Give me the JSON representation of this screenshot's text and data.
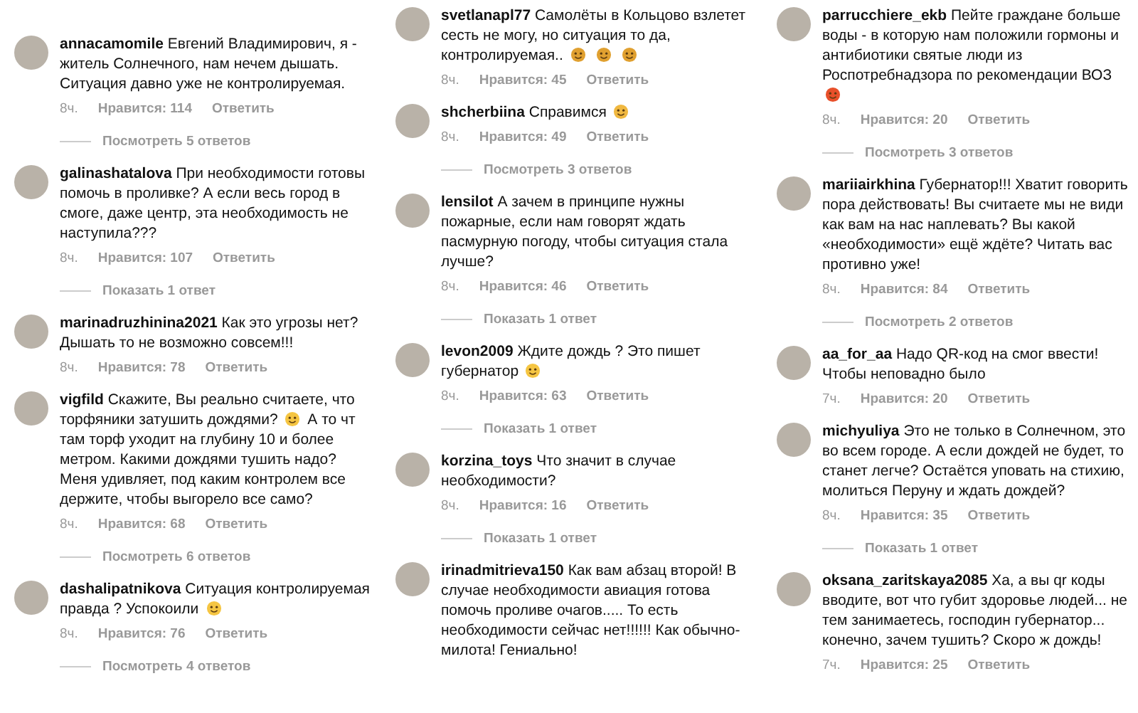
{
  "columns": [
    {
      "comments": [
        {
          "username": "annacamomile",
          "parts": [
            {
              "kind": "text",
              "text": "Евгений Владимирович, я - житель Солнечного, нам нечем дышать. Ситуация давно уже не контролируемая."
            }
          ],
          "time": "8ч.",
          "likes": "Нравится: 114",
          "reply": "Ответить",
          "replies": "Посмотреть 5 ответов"
        },
        {
          "username": "galinashatalova",
          "parts": [
            {
              "kind": "text",
              "text": "При необходимости готовы помочь в проливке? А если весь город в смоге, даже центр, эта необходимость не наступила???"
            }
          ],
          "time": "8ч.",
          "likes": "Нравится: 107",
          "reply": "Ответить",
          "replies": "Показать 1 ответ"
        },
        {
          "username": "marinadruzhinina2021",
          "parts": [
            {
              "kind": "text",
              "text": "Как это угрозы нет? Дышать то не возможно совсем!!!"
            }
          ],
          "time": "8ч.",
          "likes": "Нравится: 78",
          "reply": "Ответить"
        },
        {
          "username": "vigfild",
          "parts": [
            {
              "kind": "text",
              "text": "Скажите, Вы реально считаете, что торфяники затушить дождями?"
            },
            {
              "kind": "emoji",
              "color": "#f5c542"
            },
            {
              "kind": "text",
              "text": "А то  чт там торф уходит на глубину 10 и более метром. Какими дождями тушить надо? Меня удивляет, под каким контролем все держите, чтобы выгорело все само?"
            }
          ],
          "time": "8ч.",
          "likes": "Нравится: 68",
          "reply": "Ответить",
          "replies": "Посмотреть 6 ответов"
        },
        {
          "username": "dashalipatnikova",
          "parts": [
            {
              "kind": "text",
              "text": "Ситуация контролируемая правда ? Успокоили"
            },
            {
              "kind": "emoji",
              "color": "#f5c542"
            }
          ],
          "time": "8ч.",
          "likes": "Нравится: 76",
          "reply": "Ответить",
          "replies": "Посмотреть 4 ответов"
        }
      ]
    },
    {
      "comments": [
        {
          "username": "svetlanapl77",
          "parts": [
            {
              "kind": "text",
              "text": "Самолёты в Кольцово взлетет сесть не могу, но ситуация то да, контролируемая.."
            },
            {
              "kind": "emoji",
              "color": "#e0a030"
            },
            {
              "kind": "emoji",
              "color": "#e0a030"
            },
            {
              "kind": "emoji",
              "color": "#e0a030"
            }
          ],
          "time": "8ч.",
          "likes": "Нравится: 45",
          "reply": "Ответить"
        },
        {
          "username": "shcherbiina",
          "parts": [
            {
              "kind": "text",
              "text": "Справимся"
            },
            {
              "kind": "emoji",
              "color": "#f0b840"
            }
          ],
          "time": "8ч.",
          "likes": "Нравится: 49",
          "reply": "Ответить",
          "replies": "Посмотреть 3 ответов"
        },
        {
          "username": "lensilot",
          "parts": [
            {
              "kind": "text",
              "text": "А зачем в принципе нужны пожарные, если нам говорят ждать пасмурную погоду, чтобы ситуация стала лучше?"
            }
          ],
          "time": "8ч.",
          "likes": "Нравится: 46",
          "reply": "Ответить",
          "replies": "Показать 1 ответ"
        },
        {
          "username": "levon2009",
          "parts": [
            {
              "kind": "text",
              "text": "Ждите дождь ? Это пишет губернатор"
            },
            {
              "kind": "emoji",
              "color": "#f5c542"
            }
          ],
          "time": "8ч.",
          "likes": "Нравится: 63",
          "reply": "Ответить",
          "replies": "Показать 1 ответ"
        },
        {
          "username": "korzina_toys",
          "parts": [
            {
              "kind": "text",
              "text": "Что значит в случае необходимости?"
            }
          ],
          "time": "8ч.",
          "likes": "Нравится: 16",
          "reply": "Ответить",
          "replies": "Показать 1 ответ"
        },
        {
          "username": "irinadmitrieva150",
          "parts": [
            {
              "kind": "text",
              "text": "Как вам абзац второй! В случае необходимости авиация готова помочь проливе очагов..... То есть необходимости сейчас нет!!!!!! Как обычно-милота! Гениально!"
            }
          ]
        }
      ]
    },
    {
      "comments": [
        {
          "username": "parrucchiere_ekb",
          "parts": [
            {
              "kind": "text",
              "text": "Пейте граждане больше воды - в которую нам положили гормоны и антибиотики святые люди из Роспотребнадзора по рекомендации ВОЗ"
            },
            {
              "kind": "emoji",
              "color": "#e8502a"
            }
          ],
          "time": "8ч.",
          "likes": "Нравится: 20",
          "reply": "Ответить",
          "replies": "Посмотреть 3 ответов"
        },
        {
          "username": "mariiairkhina",
          "parts": [
            {
              "kind": "text",
              "text": "Губернатор!!! Хватит говорить пора действовать! Вы считаете мы не види как вам на нас наплевать? Вы какой «необходимости» ещё ждёте? Читать вас противно уже!"
            }
          ],
          "time": "8ч.",
          "likes": "Нравится: 84",
          "reply": "Ответить",
          "replies": "Посмотреть 2 ответов"
        },
        {
          "username": "aa_for_aa",
          "parts": [
            {
              "kind": "text",
              "text": "Надо QR-код на смог ввести! Чтобы неповадно было"
            }
          ],
          "time": "7ч.",
          "likes": "Нравится: 20",
          "reply": "Ответить"
        },
        {
          "username": "michyuliya",
          "parts": [
            {
              "kind": "text",
              "text": "Это не только в Солнечном, это во всем городе. А если дождей не будет, то станет легче? Остаётся уповать на стихию, молиться Перуну и ждать дождей?"
            }
          ],
          "time": "8ч.",
          "likes": "Нравится: 35",
          "reply": "Ответить",
          "replies": "Показать 1 ответ"
        },
        {
          "username": "oksana_zaritskaya2085",
          "parts": [
            {
              "kind": "text",
              "text": "Ха, а вы qr коды вводите, вот что губит здоровье людей... не тем занимаетесь, господин губернатор... конечно, зачем тушить? Скоро ж дождь!"
            }
          ],
          "time": "7ч.",
          "likes": "Нравится: 25",
          "reply": "Ответить"
        }
      ]
    }
  ]
}
